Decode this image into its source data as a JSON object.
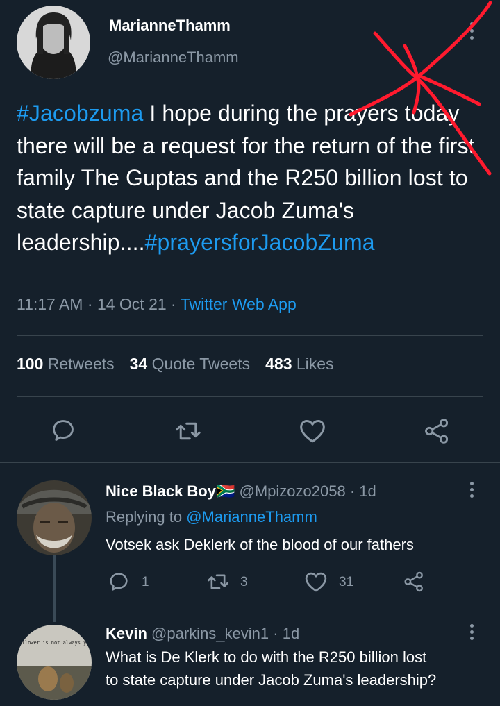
{
  "tweet": {
    "display_name": "MarianneThamm",
    "handle": "@MarianneThamm",
    "text_hashtag_start": "#Jacobzuma",
    "text_body": " I hope during the prayers today there will be a request for the return of the first family The Guptas and the R250 billion lost to state capture under Jacob Zuma's leadership....",
    "text_hashtag_end": "#prayersforJacobZuma",
    "time": "11:17 AM",
    "date": "14 Oct 21",
    "source": "Twitter Web App",
    "stats": {
      "retweets_count": "100",
      "retweets_label": "Retweets",
      "quotes_count": "34",
      "quotes_label": "Quote Tweets",
      "likes_count": "483",
      "likes_label": "Likes"
    }
  },
  "replies": [
    {
      "name": "Nice Black Boy",
      "flag": "🇿🇦",
      "handle": "@Mpizozo2058",
      "age": "1d",
      "replying_prefix": "Replying to",
      "replying_to": "@MarianneThamm",
      "text": "Votsek ask Deklerk of the blood of our fathers",
      "reply_count": "1",
      "retweet_count": "3",
      "like_count": "31"
    },
    {
      "name": "Kevin",
      "handle": "@parkins_kevin1",
      "age": "1d",
      "avatar_caption": "Your follower is not always your fan",
      "text_line1": "What is De Klerk to do with the R250 billion lost",
      "text_line2": "to state capture under Jacob Zuma's leadership?"
    }
  ],
  "colors": {
    "accent": "#1d9bf0",
    "background": "#15202b",
    "muted": "#8b98a5",
    "scribble": "#ff1a2e"
  },
  "icons": [
    "reply-icon",
    "retweet-icon",
    "like-icon",
    "share-icon",
    "more-icon"
  ]
}
